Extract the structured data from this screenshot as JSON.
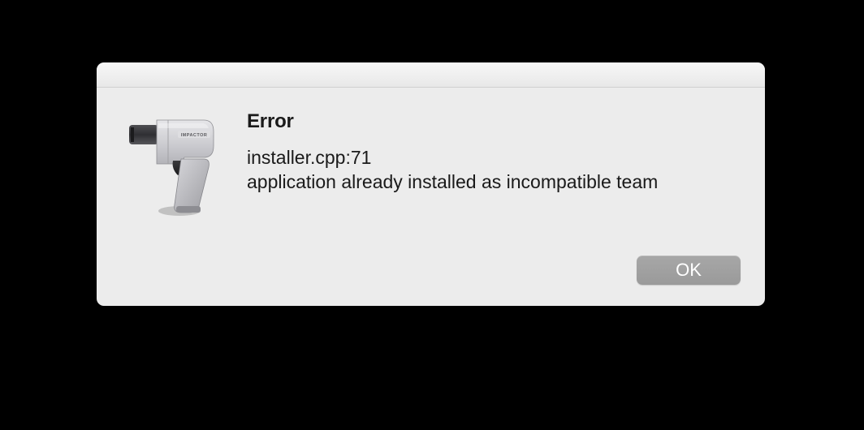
{
  "dialog": {
    "title": "Error",
    "message_line1": "installer.cpp:71",
    "message_line2": "application already installed as incompatible team",
    "ok_label": "OK",
    "icon_name": "impact-wrench-icon"
  }
}
